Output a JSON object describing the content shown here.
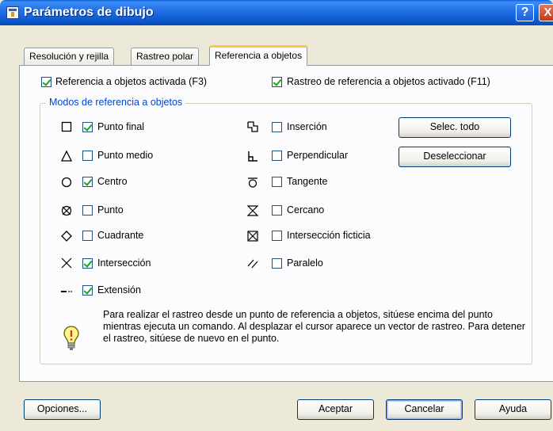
{
  "window": {
    "title": "Parámetros de dibujo",
    "help_glyph": "?",
    "close_glyph": "X"
  },
  "tabs": [
    {
      "label": "Resolución y rejilla"
    },
    {
      "label": "Rastreo polar"
    },
    {
      "label": "Referencia a objetos",
      "active": true
    }
  ],
  "top_options": {
    "osnap_on": {
      "label": "Referencia a objetos activada (F3)",
      "checked": true
    },
    "otrack_on": {
      "label": "Rastreo de referencia a objetos activado (F11)",
      "checked": true
    }
  },
  "group": {
    "title": "Modos de referencia a objetos"
  },
  "modes_left": [
    {
      "label": "Punto final",
      "checked": true,
      "icon": "square-icon"
    },
    {
      "label": "Punto medio",
      "checked": false,
      "icon": "triangle-icon"
    },
    {
      "label": "Centro",
      "checked": true,
      "icon": "circle-icon"
    },
    {
      "label": "Punto",
      "checked": false,
      "icon": "node-icon"
    },
    {
      "label": "Cuadrante",
      "checked": false,
      "icon": "diamond-icon"
    },
    {
      "label": "Intersección",
      "checked": true,
      "icon": "cross-icon"
    },
    {
      "label": "Extensión",
      "checked": true,
      "icon": "extension-icon"
    }
  ],
  "modes_right": [
    {
      "label": "Inserción",
      "checked": false,
      "icon": "insertion-icon"
    },
    {
      "label": "Perpendicular",
      "checked": false,
      "icon": "perpendicular-icon"
    },
    {
      "label": "Tangente",
      "checked": false,
      "icon": "tangent-icon"
    },
    {
      "label": "Cercano",
      "checked": false,
      "icon": "nearest-icon"
    },
    {
      "label": "Intersección ficticia",
      "checked": false,
      "icon": "apparent-intersection-icon"
    },
    {
      "label": "Paralelo",
      "checked": false,
      "icon": "parallel-icon"
    }
  ],
  "side_buttons": {
    "select_all": "Selec. todo",
    "clear_all": "Deseleccionar"
  },
  "info_text": "Para realizar el rastreo desde un punto de referencia a objetos, sitúese encima del punto mientras ejecuta un comando. Al desplazar el cursor aparece un vector de rastreo. Para detener el rastreo, sitúese de nuevo en el punto.",
  "footer": {
    "options": "Opciones...",
    "ok": "Aceptar",
    "cancel": "Cancelar",
    "help": "Ayuda"
  },
  "colors": {
    "titlebar": "#0A56C8",
    "group_title": "#0046D5",
    "check": "#21A121",
    "tab_accent": "#FFC83C"
  }
}
